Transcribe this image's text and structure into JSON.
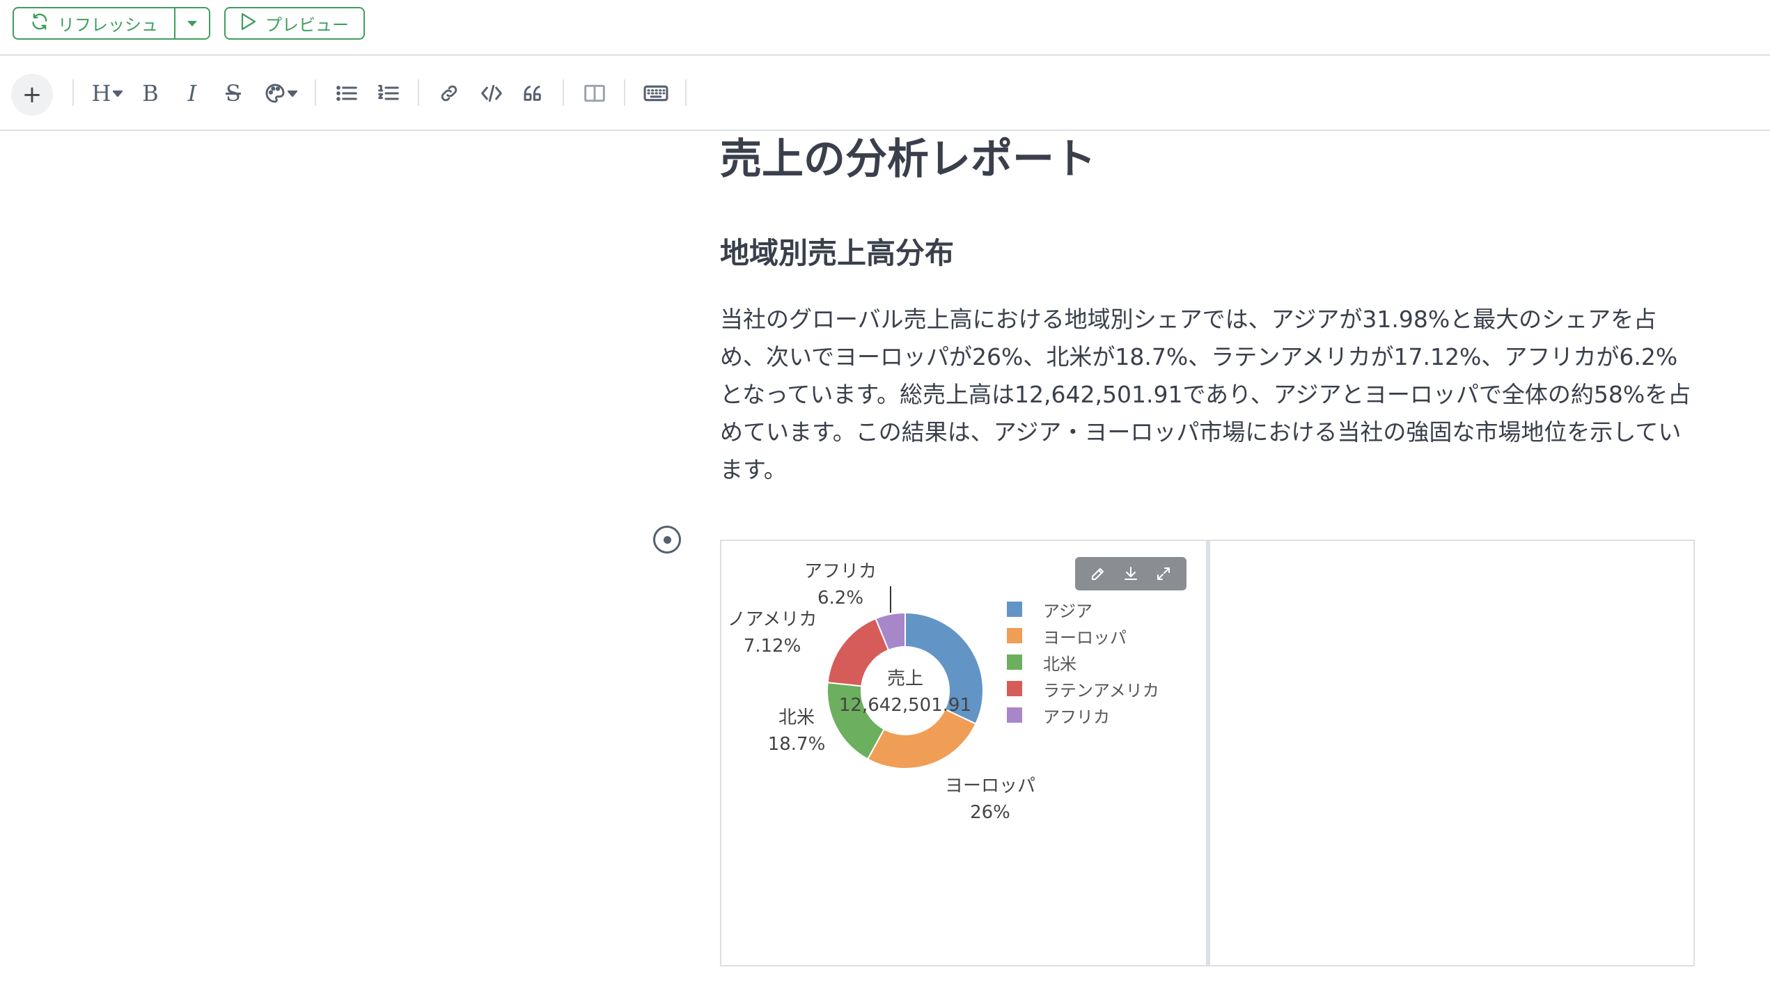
{
  "topbar": {
    "refresh_label": "リフレッシュ",
    "preview_label": "プレビュー",
    "accent_color": "#3f9d5e"
  },
  "toolbar": {
    "plus_label": "+",
    "heading_label": "H",
    "bold_label": "B",
    "italic_label": "I",
    "strike_label": "S"
  },
  "document": {
    "title": "売上の分析レポート",
    "section_heading": "地域別売上高分布",
    "paragraph": "当社のグローバル売上高における地域別シェアでは、アジアが31.98%と最大のシェアを占め、次いでヨーロッパが26%、北米が18.7%、ラテンアメリカが17.12%、アフリカが6.2%となっています。総売上高は12,642,501.91であり、アジアとヨーロッパで全体の約58%を占めています。この結果は、アジア・ヨーロッパ市場における当社の強固な市場地位を示しています。"
  },
  "chart_data": {
    "type": "pie",
    "variant": "donut",
    "center_label": "売上",
    "center_value": "12,642,501.91",
    "legend_position": "right",
    "slices": [
      {
        "name": "アジア",
        "value": 31.98,
        "label": "",
        "color": "#6394c6"
      },
      {
        "name": "ヨーロッパ",
        "value": 26,
        "label": "26%",
        "color": "#f09d56"
      },
      {
        "name": "北米",
        "value": 18.7,
        "label": "18.7%",
        "color": "#6caf5f"
      },
      {
        "name": "ラテンアメリカ",
        "value": 17.12,
        "label": "7.12%",
        "label_name": "ノアメリカ",
        "color": "#d65c5a"
      },
      {
        "name": "アフリカ",
        "value": 6.2,
        "label": "6.2%",
        "color": "#a787c9"
      }
    ]
  }
}
